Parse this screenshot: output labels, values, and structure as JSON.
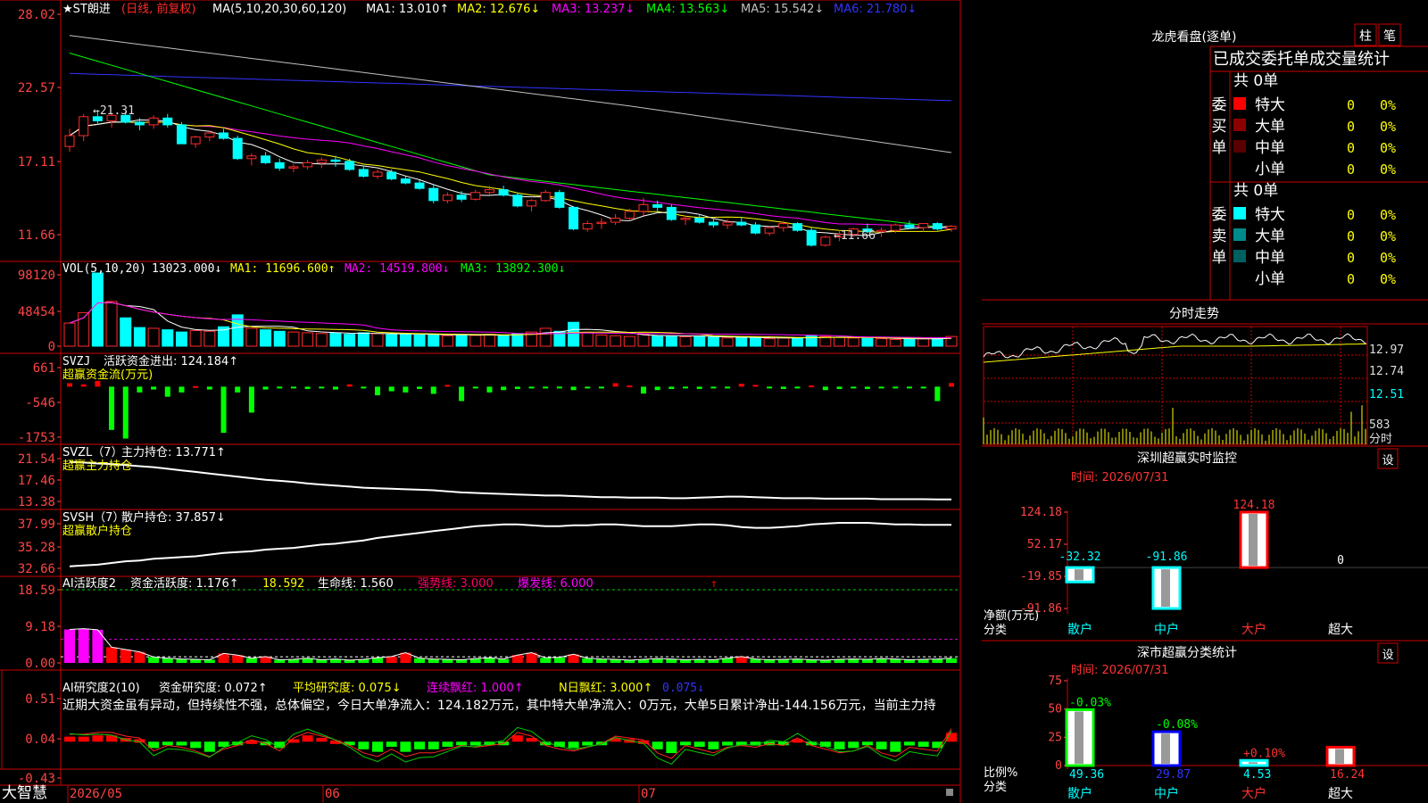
{
  "app": {
    "brand": "大智慧"
  },
  "colors": {
    "up": "#ff2a2a",
    "down": "#00ffff",
    "ma1": "#ffffff",
    "ma2": "#ffff00",
    "ma3": "#ff00ff",
    "ma4": "#00ff00",
    "ma5": "#c0c0c0",
    "ma6": "#3333ff",
    "frame": "#cc0000",
    "axis": "#ff4444"
  },
  "price": {
    "stock": "★ST朗进",
    "mode": "(日线, 前复权)",
    "ma_label": "MA(5,10,20,30,60,120)",
    "ma1_label": "MA1: 13.010↑",
    "ma2_label": "MA2: 12.676↓",
    "ma3_label": "MA3: 13.237↓",
    "ma4_label": "MA4: 13.563↓",
    "ma5_label": "MA5: 15.542↓",
    "ma6_label": "MA6: 21.780↓",
    "ticks": [
      "28.02",
      "22.57",
      "17.11",
      "11.66"
    ],
    "high_label": "←21.31",
    "low_label": "←11.66",
    "ohlc": [
      [
        18.6,
        19.9,
        18.2,
        19.4
      ],
      [
        19.4,
        21.0,
        19.0,
        20.8
      ],
      [
        20.8,
        21.31,
        20.2,
        20.5
      ],
      [
        20.5,
        21.0,
        20.0,
        20.9
      ],
      [
        20.9,
        21.2,
        20.3,
        20.4
      ],
      [
        20.4,
        20.7,
        19.8,
        20.2
      ],
      [
        20.2,
        20.9,
        19.9,
        20.7
      ],
      [
        20.7,
        21.0,
        20.0,
        20.2
      ],
      [
        20.2,
        20.4,
        18.8,
        18.8
      ],
      [
        18.8,
        19.4,
        18.5,
        19.3
      ],
      [
        19.3,
        19.8,
        19.0,
        19.6
      ],
      [
        19.6,
        19.9,
        19.1,
        19.2
      ],
      [
        19.2,
        19.4,
        17.6,
        17.7
      ],
      [
        17.7,
        18.1,
        17.2,
        17.9
      ],
      [
        17.9,
        18.2,
        17.3,
        17.4
      ],
      [
        17.4,
        17.7,
        16.8,
        17.0
      ],
      [
        17.0,
        17.3,
        16.7,
        17.1
      ],
      [
        17.1,
        17.6,
        16.9,
        17.4
      ],
      [
        17.4,
        17.8,
        17.0,
        17.6
      ],
      [
        17.6,
        17.9,
        17.1,
        17.5
      ],
      [
        17.5,
        17.7,
        16.8,
        16.9
      ],
      [
        16.9,
        17.2,
        16.3,
        16.4
      ],
      [
        16.4,
        16.9,
        16.2,
        16.7
      ],
      [
        16.7,
        16.9,
        16.1,
        16.2
      ],
      [
        16.2,
        16.4,
        15.8,
        15.9
      ],
      [
        15.9,
        16.1,
        15.4,
        15.5
      ],
      [
        15.5,
        15.8,
        14.4,
        14.6
      ],
      [
        14.6,
        15.2,
        14.4,
        15.0
      ],
      [
        15.0,
        15.3,
        14.5,
        14.7
      ],
      [
        14.7,
        15.4,
        14.6,
        15.2
      ],
      [
        15.2,
        15.7,
        15.0,
        15.4
      ],
      [
        15.4,
        15.7,
        14.9,
        15.0
      ],
      [
        15.0,
        15.2,
        14.1,
        14.2
      ],
      [
        14.2,
        14.7,
        13.8,
        14.6
      ],
      [
        14.6,
        15.4,
        14.5,
        15.2
      ],
      [
        15.2,
        15.4,
        14.0,
        14.1
      ],
      [
        14.1,
        14.2,
        12.4,
        12.5
      ],
      [
        12.5,
        13.1,
        12.3,
        12.9
      ],
      [
        12.9,
        13.3,
        12.5,
        13.0
      ],
      [
        13.0,
        13.6,
        12.8,
        13.3
      ],
      [
        13.3,
        14.0,
        13.1,
        13.8
      ],
      [
        13.8,
        14.8,
        13.5,
        14.3
      ],
      [
        14.3,
        14.6,
        13.7,
        14.1
      ],
      [
        14.1,
        14.3,
        13.1,
        13.2
      ],
      [
        13.2,
        13.5,
        12.8,
        13.3
      ],
      [
        13.3,
        13.6,
        12.9,
        13.0
      ],
      [
        13.0,
        13.3,
        12.6,
        12.8
      ],
      [
        12.8,
        13.2,
        12.5,
        13.0
      ],
      [
        13.0,
        13.4,
        12.7,
        12.8
      ],
      [
        12.8,
        13.0,
        12.1,
        12.2
      ],
      [
        12.2,
        12.7,
        12.0,
        12.6
      ],
      [
        12.6,
        13.1,
        12.3,
        12.9
      ],
      [
        12.9,
        13.0,
        12.3,
        12.4
      ],
      [
        12.4,
        12.6,
        11.2,
        11.3
      ],
      [
        11.3,
        12.0,
        11.2,
        11.9
      ],
      [
        11.9,
        12.4,
        11.6,
        12.1
      ],
      [
        12.1,
        12.6,
        11.9,
        12.5
      ],
      [
        12.5,
        12.9,
        12.2,
        12.3
      ],
      [
        12.3,
        12.6,
        11.9,
        12.4
      ],
      [
        12.4,
        12.9,
        12.2,
        12.8
      ],
      [
        12.8,
        13.1,
        12.5,
        12.6
      ],
      [
        12.6,
        12.9,
        12.3,
        12.9
      ],
      [
        12.9,
        13.0,
        12.4,
        12.5
      ],
      [
        12.5,
        12.8,
        12.3,
        12.7
      ]
    ]
  },
  "volume": {
    "label": "VOL(5,10,20)",
    "value": "13023.000↓",
    "ma1": "MA1: 11696.600↑",
    "ma2": "MA2: 14519.800↓",
    "ma3": "MA3: 13892.300↓",
    "ticks": [
      "98120",
      "48454",
      "0"
    ],
    "values": [
      31000,
      45000,
      98120,
      60000,
      38000,
      25000,
      24000,
      22000,
      19000,
      21000,
      20000,
      26000,
      42000,
      24000,
      22000,
      20000,
      19000,
      18000,
      17000,
      17500,
      16000,
      18000,
      17000,
      15500,
      16000,
      15000,
      16000,
      14000,
      15000,
      14500,
      16000,
      14000,
      17000,
      19000,
      24000,
      20000,
      32000,
      18000,
      15000,
      14000,
      13000,
      16000,
      14000,
      13500,
      12500,
      13000,
      12000,
      11000,
      12000,
      11500,
      10000,
      11000,
      10500,
      14000,
      13000,
      12000,
      11000,
      10500,
      10000,
      9000,
      9500,
      10000,
      11000,
      13023
    ]
  },
  "svzj": {
    "label": "SVZJ",
    "name": "活跃资金进出: 124.184↑",
    "sub": "超赢资金流(万元)",
    "ticks": [
      "661",
      "-546",
      "-1753"
    ],
    "values": [
      120,
      80,
      200,
      -1500,
      -1800,
      -200,
      -100,
      -350,
      -200,
      20,
      -100,
      -1600,
      -200,
      -900,
      -100,
      -40,
      -60,
      -80,
      -40,
      -100,
      80,
      -60,
      -300,
      -160,
      -200,
      -80,
      -250,
      60,
      -500,
      -40,
      -200,
      -120,
      -80,
      -40,
      -30,
      -60,
      -120,
      -60,
      -20,
      120,
      40,
      -240,
      -120,
      -80,
      -60,
      -80,
      -60,
      -40,
      100,
      60,
      -40,
      -80,
      -60,
      40,
      -120,
      -80,
      -60,
      -80,
      -40,
      -60,
      -60,
      -40,
      -500,
      124
    ]
  },
  "svzl": {
    "label": "SVZL（7）",
    "name": "主力持仓: 13.771↑",
    "sub": "超赢主力持仓",
    "ticks": [
      "21.54",
      "17.46",
      "13.38"
    ],
    "values": [
      20.9,
      20.8,
      20.6,
      20.5,
      20.3,
      20.1,
      19.9,
      19.6,
      19.3,
      19.0,
      18.7,
      18.4,
      18.1,
      17.8,
      17.5,
      17.3,
      17.1,
      16.8,
      16.6,
      16.4,
      16.2,
      16.0,
      15.9,
      15.8,
      15.7,
      15.6,
      15.5,
      15.3,
      15.1,
      15.0,
      14.9,
      14.8,
      14.7,
      14.6,
      14.5,
      14.5,
      14.4,
      14.3,
      14.2,
      14.2,
      14.1,
      14.1,
      14.1,
      14.0,
      14.0,
      14.1,
      14.2,
      14.3,
      14.3,
      14.2,
      14.1,
      14.0,
      14.0,
      14.0,
      13.9,
      13.9,
      13.9,
      13.9,
      13.8,
      13.8,
      13.8,
      13.8,
      13.77,
      13.77
    ]
  },
  "svsh": {
    "label": "SVSH（7）",
    "name": "散户持仓: 37.857↓",
    "sub": "超赢散户持仓",
    "ticks": [
      "37.99",
      "35.28",
      "32.66"
    ],
    "values": [
      32.9,
      33.0,
      33.1,
      33.3,
      33.5,
      33.6,
      33.8,
      33.9,
      34.0,
      34.1,
      34.3,
      34.5,
      34.6,
      34.7,
      34.9,
      35.0,
      35.1,
      35.3,
      35.5,
      35.6,
      35.8,
      36.0,
      36.3,
      36.5,
      36.7,
      36.9,
      37.1,
      37.3,
      37.5,
      37.7,
      37.8,
      37.9,
      37.9,
      37.8,
      37.7,
      37.7,
      37.8,
      37.8,
      37.9,
      37.9,
      37.8,
      37.7,
      37.7,
      37.7,
      37.8,
      37.9,
      37.9,
      37.8,
      37.6,
      37.5,
      37.5,
      37.6,
      37.7,
      37.9,
      38.0,
      38.1,
      38.1,
      38.1,
      38.0,
      37.9,
      37.9,
      37.86,
      37.86,
      37.86
    ]
  },
  "ai_active": {
    "label": "AI活跃度2",
    "name": "资金活跃度: 1.176↑",
    "v2": "18.592",
    "v3": "生命线: 1.560",
    "v4": "强势线: 3.000",
    "v5": "爆发线: 6.000",
    "arrow": "↑",
    "ticks": [
      "18.59",
      "9.18",
      "0.00"
    ],
    "values": [
      8.5,
      8.7,
      8.4,
      4.0,
      3.4,
      2.8,
      1.5,
      1.2,
      1.0,
      0.9,
      0.8,
      2.4,
      2.0,
      1.2,
      1.6,
      0.8,
      0.9,
      1.2,
      0.8,
      1.0,
      0.7,
      0.9,
      1.3,
      1.6,
      2.6,
      1.2,
      1.0,
      0.9,
      0.8,
      1.1,
      1.3,
      1.0,
      2.0,
      2.6,
      1.3,
      1.4,
      2.2,
      1.2,
      1.0,
      0.9,
      0.7,
      0.9,
      1.1,
      1.0,
      0.8,
      0.9,
      0.8,
      1.2,
      1.6,
      1.0,
      0.8,
      0.9,
      1.0,
      0.8,
      0.7,
      0.9,
      1.0,
      0.9,
      1.1,
      1.0,
      0.8,
      0.9,
      1.0,
      1.2
    ]
  },
  "ai_research": {
    "label": "AI研究度2(10)",
    "name": "资金研究度: 0.072↑",
    "avg": "平均研究度: 0.075↓",
    "red": "连续飘红: 1.000↑",
    "n_red": "N日飘红: 3.000↑",
    "extra": "0.075↓",
    "desc": "近期大资金虽有异动，但持续性不强，总体偏空，今日大单净流入：124.182万元，其中特大单净流入：0万元，大单5日累计净出-144.156万元，当前主力持",
    "ticks": [
      "0.51",
      "0.04",
      "-0.43"
    ],
    "values": [
      0.04,
      0.04,
      0.05,
      0.05,
      0.03,
      0.02,
      -0.05,
      -0.02,
      -0.03,
      -0.05,
      -0.08,
      -0.04,
      -0.02,
      0.01,
      -0.01,
      -0.05,
      0.02,
      0.05,
      0.03,
      0.01,
      -0.02,
      -0.06,
      -0.08,
      -0.04,
      -0.08,
      -0.06,
      -0.06,
      -0.04,
      -0.02,
      -0.03,
      -0.02,
      -0.01,
      0.05,
      0.03,
      -0.02,
      -0.04,
      -0.05,
      -0.03,
      -0.01,
      0.03,
      0.02,
      0.01,
      -0.06,
      -0.09,
      -0.02,
      -0.04,
      -0.06,
      -0.03,
      -0.02,
      -0.03,
      -0.01,
      -0.02,
      0.02,
      -0.02,
      -0.04,
      -0.06,
      -0.05,
      -0.02,
      -0.06,
      -0.08,
      -0.03,
      -0.04,
      -0.05,
      0.07
    ]
  },
  "dates": [
    "2026/05",
    "06",
    "07"
  ],
  "dragon": {
    "title": "龙虎看盘(逐单)",
    "btn1": "柱",
    "btn2": "笔",
    "header": "已成交委托单成交量统计",
    "buy_label": "委买单",
    "sell_label": "委卖单",
    "buy_total": "共 0单",
    "sell_total": "共 0单",
    "rows": [
      {
        "name": "特大",
        "v": "0",
        "p": "0%"
      },
      {
        "name": "大单",
        "v": "0",
        "p": "0%"
      },
      {
        "name": "中单",
        "v": "0",
        "p": "0%"
      },
      {
        "name": "小单",
        "v": "0",
        "p": "0%"
      }
    ],
    "buy_colors": [
      "#ff0000",
      "#8b0000",
      "#5a0000",
      ""
    ],
    "sell_colors": [
      "#00ffff",
      "#008b8b",
      "#006060",
      ""
    ]
  },
  "intraday": {
    "title": "分时走势",
    "ticks": [
      "12.97",
      "12.74",
      "12.51"
    ],
    "vol_tick": "583",
    "vol_label": "分时"
  },
  "monitor": {
    "title": "深圳超赢实时监控",
    "btn": "设",
    "time": "时间: 2026/07/31",
    "ticks": [
      "124.18",
      "52.17",
      "-19.85",
      "-91.86"
    ],
    "axis_label1": "净额(万元)",
    "axis_label2": "分类",
    "cats": [
      "散户",
      "中户",
      "大户",
      "超大"
    ],
    "values": [
      -32.32,
      -91.86,
      124.18,
      0
    ],
    "labels": [
      "-32.32",
      "-91.86",
      "124.18",
      "0"
    ]
  },
  "classify": {
    "title": "深市超赢分类统计",
    "btn": "设",
    "time": "时间: 2026/07/31",
    "ticks": [
      "75",
      "50",
      "25",
      "0"
    ],
    "axis_label1": "比例%",
    "axis_label2": "分类",
    "cats": [
      "散户",
      "中户",
      "大户",
      "超大"
    ],
    "values": [
      49.36,
      29.87,
      4.53,
      16.24
    ],
    "labels": [
      "49.36",
      "29.87",
      "4.53",
      "16.24"
    ],
    "changes": [
      "-0.03%",
      "-0.08%",
      "+0.10%",
      ""
    ]
  }
}
